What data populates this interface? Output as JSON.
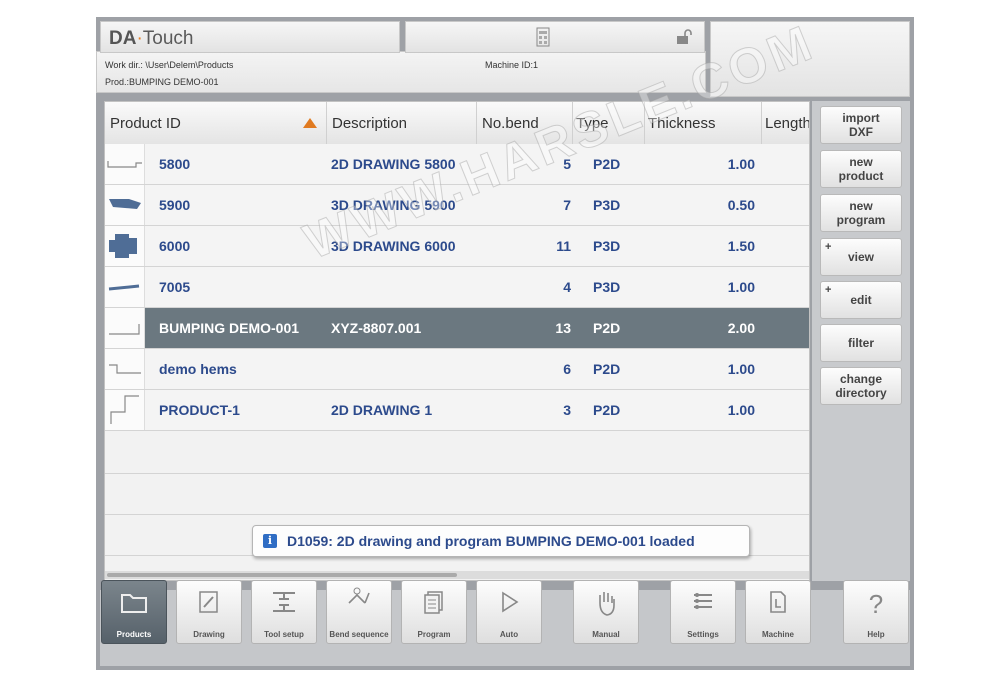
{
  "header": {
    "logo_brand": "DA",
    "logo_sep": "·",
    "logo_product": "Touch",
    "work_dir": "Work dir.: \\User\\Delem\\Products",
    "product": "Prod.:BUMPING DEMO-001",
    "machine_id": "Machine ID:1"
  },
  "table": {
    "columns": [
      "Product ID",
      "Description",
      "No.bend",
      "Type",
      "Thickness",
      "Length"
    ],
    "rows": [
      {
        "id": "5800",
        "description": "2D DRAWING 5800",
        "bends": "5",
        "type": "P2D",
        "thickness": "1.00",
        "selected": false
      },
      {
        "id": "5900",
        "description": "3D DRAWING 5900",
        "bends": "7",
        "type": "P3D",
        "thickness": "0.50",
        "selected": false
      },
      {
        "id": "6000",
        "description": "3D DRAWING 6000",
        "bends": "11",
        "type": "P3D",
        "thickness": "1.50",
        "selected": false
      },
      {
        "id": "7005",
        "description": "",
        "bends": "4",
        "type": "P3D",
        "thickness": "1.00",
        "selected": false
      },
      {
        "id": "BUMPING DEMO-001",
        "description": "XYZ-8807.001",
        "bends": "13",
        "type": "P2D",
        "thickness": "2.00",
        "selected": true
      },
      {
        "id": "demo hems",
        "description": "",
        "bends": "6",
        "type": "P2D",
        "thickness": "1.00",
        "selected": false
      },
      {
        "id": "PRODUCT-1",
        "description": "2D DRAWING 1",
        "bends": "3",
        "type": "P2D",
        "thickness": "1.00",
        "selected": false
      }
    ]
  },
  "message": {
    "icon": "info-icon",
    "text": "D1059: 2D drawing and program BUMPING DEMO-001 loaded"
  },
  "side_buttons": [
    {
      "line1": "import",
      "line2": "DXF"
    },
    {
      "line1": "new",
      "line2": "product"
    },
    {
      "line1": "new",
      "line2": "program"
    },
    {
      "line1": "view",
      "line2": ""
    },
    {
      "line1": "edit",
      "line2": ""
    },
    {
      "line1": "filter",
      "line2": ""
    },
    {
      "line1": "change",
      "line2": "directory"
    }
  ],
  "tabs": [
    {
      "label": "Products",
      "icon": "folder-icon",
      "active": true
    },
    {
      "label": "Drawing",
      "icon": "pencil-icon",
      "active": false
    },
    {
      "label": "Tool setup",
      "icon": "press-tool-icon",
      "active": false
    },
    {
      "label": "Bend sequence",
      "icon": "bend-sequence-icon",
      "active": false
    },
    {
      "label": "Program",
      "icon": "program-pages-icon",
      "active": false
    },
    {
      "label": "Auto",
      "icon": "play-icon",
      "active": false
    },
    {
      "label": "Manual",
      "icon": "hand-icon",
      "active": false
    },
    {
      "label": "Settings",
      "icon": "settings-list-icon",
      "active": false
    },
    {
      "label": "Machine",
      "icon": "machine-icon",
      "active": false
    },
    {
      "label": "Help",
      "icon": "help-icon",
      "active": false
    }
  ],
  "watermark": "WWW.HARSLE.COM",
  "colors": {
    "selected_row": "#6b7880",
    "text_blue": "#2c4a8c",
    "sort_arrow": "#e07a20"
  }
}
